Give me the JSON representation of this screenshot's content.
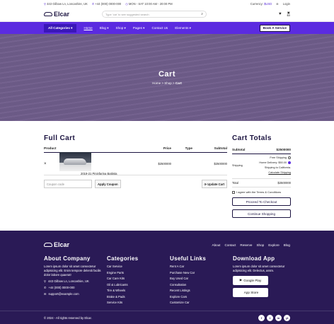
{
  "topbar": {
    "address": "443 Gilbow Ln, Loncashire, UK",
    "phone": "+44 (000) 0000-000",
    "hours": "MON - SAT 10:00 AM - 20:00 PM",
    "currency_label": "Currency:",
    "currency_value": "$USD",
    "login": "Login"
  },
  "header": {
    "brand": "Elcar",
    "search_placeholder": "Type 'car' to see suggested search",
    "cart_count": "0",
    "cart_amount": "$0"
  },
  "nav": {
    "all_categories": "All Categories",
    "items": [
      "Home",
      "Blog",
      "Shop",
      "Pages",
      "Contact Us",
      "Elements"
    ],
    "book_service": "Book A Service"
  },
  "banner": {
    "title": "Cart",
    "crumb_home": "Home",
    "crumb_shop": "Shop",
    "crumb_current": "Cart"
  },
  "full_cart": {
    "title": "Full Cart",
    "headers": [
      "Product",
      "Price",
      "Type",
      "Subtotal"
    ],
    "row": {
      "remove": "×",
      "name": "2019-21 Pininfarina Battista",
      "price": "$2500000",
      "type": "",
      "subtotal": "$2500000"
    },
    "coupon_placeholder": "Coupon code",
    "apply_coupon": "Apply Coupon",
    "update_cart": "Update Cart"
  },
  "cart_totals": {
    "title": "Cart Totals",
    "subtotal_label": "Subtotal",
    "subtotal_value": "$2500000",
    "shipping_label": "Shipping",
    "free_shipping": "Free Shipping",
    "home_delivery": "Home Delivery: $50.00",
    "shipping_to": "Shipping to California.",
    "calc_shipping": "Calculate Shipping",
    "total_label": "Total",
    "total_value": "$2500000",
    "agree": "I agree with the Terms & Conditions",
    "checkout": "Proceed To Checkout",
    "continue": "Continue Shopping"
  },
  "footer": {
    "brand": "Elcar",
    "links": [
      "About",
      "Contact",
      "Reserve",
      "Shop",
      "Explore",
      "Blog"
    ],
    "about_title": "About Company",
    "about_text": "Lorem ipsum dolor sit amet consectetur adipisicing elit. Enim tempore deleniti facilis dolor labore quaerat!",
    "address": "443 Gilbow Ln, Loncashire, UK",
    "phone": "+44 (000) 0000-000",
    "email": "support@example.com",
    "categories_title": "Categories",
    "categories": [
      "Car Service",
      "Engine Parts",
      "Car Care Kits",
      "Oil & Lubricants",
      "Tire & Wheels",
      "Brake & Pads",
      "Service Kits"
    ],
    "useful_title": "Useful Links",
    "useful": [
      "Rent A Car",
      "Purchase New Car",
      "Buy Used Car",
      "Consultation",
      "Recent Listings",
      "Explore Cars",
      "Customize Car"
    ],
    "app_title": "Download App",
    "app_text": "Lorem ipsum dolor sit amet consectetur adipisicing elit. Delectus, assm.",
    "google_play": "Google Play",
    "app_store": "App Store",
    "copyright": "© 2024 - All rights reserved by Elcar.",
    "socials": [
      "f",
      "t",
      "in",
      "yt"
    ]
  }
}
